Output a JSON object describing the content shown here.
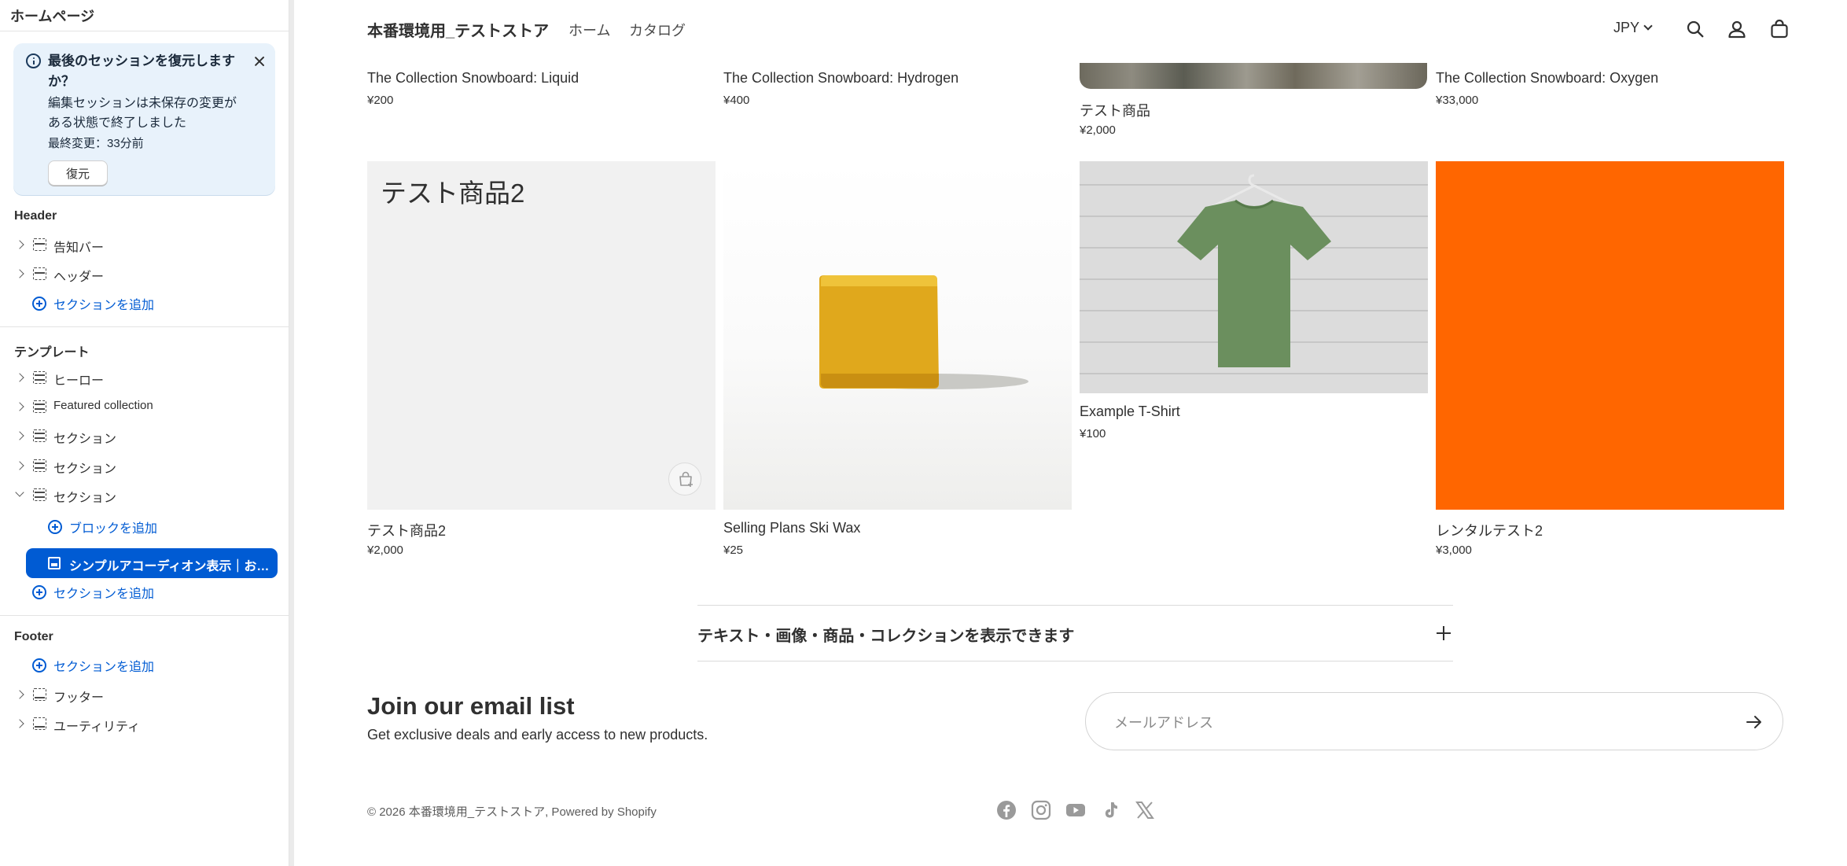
{
  "sidebar": {
    "title": "ホームページ",
    "restore": {
      "title": "最後のセッションを復元しますか？",
      "body": "編集セッションは未保存の変更がある状態で終了しました",
      "last_changed": "最終変更：33分前",
      "button": "復元"
    },
    "header_group": {
      "heading": "Header",
      "items": [
        "告知バー",
        "ヘッダー"
      ],
      "add_section": "セクションを追加"
    },
    "template_group": {
      "heading": "テンプレート",
      "items": [
        "ヒーロー",
        "Featured collection",
        "セクション",
        "セクション",
        "セクション"
      ],
      "add_block": "ブロックを追加",
      "selected_block": "シンプルアコーディオン表示｜お手...",
      "add_section": "セクションを追加"
    },
    "footer_group": {
      "heading": "Footer",
      "add_section": "セクションを追加",
      "items": [
        "フッター",
        "ユーティリティ"
      ]
    }
  },
  "store": {
    "name": "本番環境用_テストストア",
    "nav": [
      "ホーム",
      "カタログ"
    ],
    "currency": "JPY",
    "row1": [
      {
        "name": "The Collection Snowboard: Liquid",
        "price": "¥200"
      },
      {
        "name": "The Collection Snowboard: Hydrogen",
        "price": "¥400"
      },
      {
        "name": "テスト商品",
        "price": "¥2,000"
      },
      {
        "name": "The Collection Snowboard: Oxygen",
        "price": "¥33,000"
      }
    ],
    "row2": [
      {
        "name": "テスト商品2",
        "price": "¥2,000",
        "placeholder": "テスト商品2"
      },
      {
        "name": "Selling Plans Ski Wax",
        "price": "¥25"
      },
      {
        "name": "Example T-Shirt",
        "price": "¥100"
      },
      {
        "name": "レンタルテスト2",
        "price": "¥3,000"
      }
    ],
    "accordion_title": "テキスト・画像・商品・コレクションを表示できます",
    "email": {
      "title": "Join our email list",
      "subtitle": "Get exclusive deals and early access to new products.",
      "placeholder": "メールアドレス"
    },
    "copyright": "© 2026 本番環境用_テストストア, Powered by Shopify",
    "social_icons": [
      "facebook-icon",
      "instagram-icon",
      "youtube-icon",
      "tiktok-icon",
      "x-icon"
    ],
    "colors": {
      "accent": "#005bd3",
      "orange": "#ff6600",
      "tshirt": "#6b8f5e",
      "wax": "#e0a81c"
    }
  }
}
